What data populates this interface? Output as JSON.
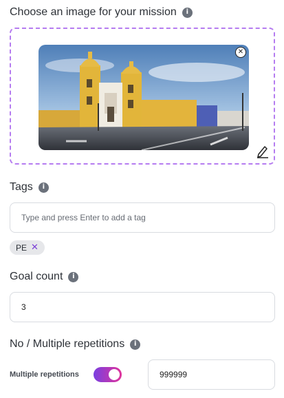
{
  "image_section": {
    "label": "Choose an image for your mission",
    "info_icon": "info-icon",
    "remove_icon": "close-circle-icon",
    "edit_icon": "pencil-icon"
  },
  "tags": {
    "label": "Tags",
    "placeholder": "Type and press Enter to add a tag",
    "chips": [
      {
        "label": "PE"
      }
    ]
  },
  "goal": {
    "label": "Goal count",
    "value": "3"
  },
  "repetitions": {
    "label": "No / Multiple repetitions",
    "toggle_label": "Multiple repetitions",
    "toggle_on": true,
    "value": "999999"
  },
  "colors": {
    "dropzone_border": "#b57cf0",
    "toggle_start": "#7a3fe0",
    "toggle_end": "#e0339b",
    "chip_x": "#7b3fd6"
  }
}
